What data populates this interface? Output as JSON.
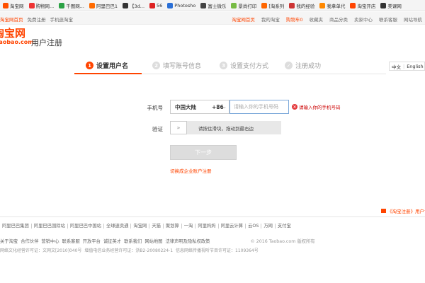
{
  "bookmarks": [
    {
      "label": "淘宝网",
      "color": "#ff5000",
      "icon": "taobao-icon"
    },
    {
      "label": "购物网...",
      "color": "#e33",
      "icon": "shop-icon"
    },
    {
      "label": "千图网...",
      "color": "#2ba245",
      "icon": "qiantu-icon"
    },
    {
      "label": "阿里巴巴1",
      "color": "#ff6a00",
      "icon": "alibaba-icon"
    },
    {
      "label": "【3d...",
      "color": "#333",
      "icon": "3d-icon"
    },
    {
      "label": "56",
      "color": "#d22",
      "icon": "56-icon"
    },
    {
      "label": "Photosho",
      "color": "#2a6fd6",
      "icon": "photoshop-icon"
    },
    {
      "label": "富士微乐",
      "color": "#444",
      "icon": "fuji-icon"
    },
    {
      "label": "景尚打印",
      "color": "#7b4",
      "icon": "print-icon"
    },
    {
      "label": "[淘系列",
      "color": "#f60",
      "icon": "taoxi-icon"
    },
    {
      "label": "我的经验",
      "color": "#c33",
      "icon": "jingyan-icon"
    },
    {
      "label": "我拿单代",
      "color": "#f80",
      "icon": "daidan-icon"
    },
    {
      "label": "淘宝开店",
      "color": "#f40",
      "icon": "kaidian-icon"
    },
    {
      "label": "美课网",
      "color": "#333",
      "icon": "meike-icon"
    }
  ],
  "topbar": {
    "left": [
      "淘宝网首页",
      "免费注册",
      "手机逛淘宝"
    ],
    "right": [
      "淘宝网首页",
      "我的淘宝",
      "购物车0",
      "收藏夹",
      "商品分类",
      "卖家中心",
      "联系客服",
      "网站导航"
    ]
  },
  "header": {
    "logo_big": "淘宝网",
    "logo_small": "Taobao.com",
    "title": "用户注册"
  },
  "steps": [
    {
      "num": "1",
      "label": "设置用户名",
      "active": true
    },
    {
      "num": "2",
      "label": "填写账号信息",
      "active": false
    },
    {
      "num": "3",
      "label": "设置支付方式",
      "active": false
    },
    {
      "num": "✓",
      "label": "注册成功",
      "active": false
    }
  ],
  "lang": {
    "zh": "中文",
    "en": "English"
  },
  "form": {
    "phone_label": "手机号",
    "country": "中国大陆",
    "country_code": "+86",
    "phone_placeholder": "请输入你的手机号码",
    "phone_error": "请输入你的手机号码",
    "verify_label": "验证",
    "slider_hint": "请按住滑块，拖动到最右边",
    "next_button": "下一步",
    "enterprise_link": "切换成企业账户注册"
  },
  "protocol_link": "《淘宝注册》用户协议",
  "footer": {
    "links": [
      "阿里巴巴集团",
      "阿里巴巴国际站",
      "阿里巴巴中国站",
      "全球速卖通",
      "淘宝网",
      "天猫",
      "聚划算",
      "一淘",
      "阿里妈妈",
      "阿里云计算",
      "云OS",
      "万网",
      "支付宝"
    ],
    "row2": [
      "关于淘宝",
      "合作伙伴",
      "营销中心",
      "联系客服",
      "开放平台",
      "诚征英才",
      "联系我们",
      "网站地图",
      "法律声明及隐私权政策"
    ],
    "copyright": "© 2016 Taobao.com 版权所有",
    "row3": [
      "网络文化经营许可证：文网文[2010]040号",
      "增值电信业务经营许可证：浙B2-20080224-1",
      "信息网络传播视听节目许可证：1109364号"
    ]
  }
}
